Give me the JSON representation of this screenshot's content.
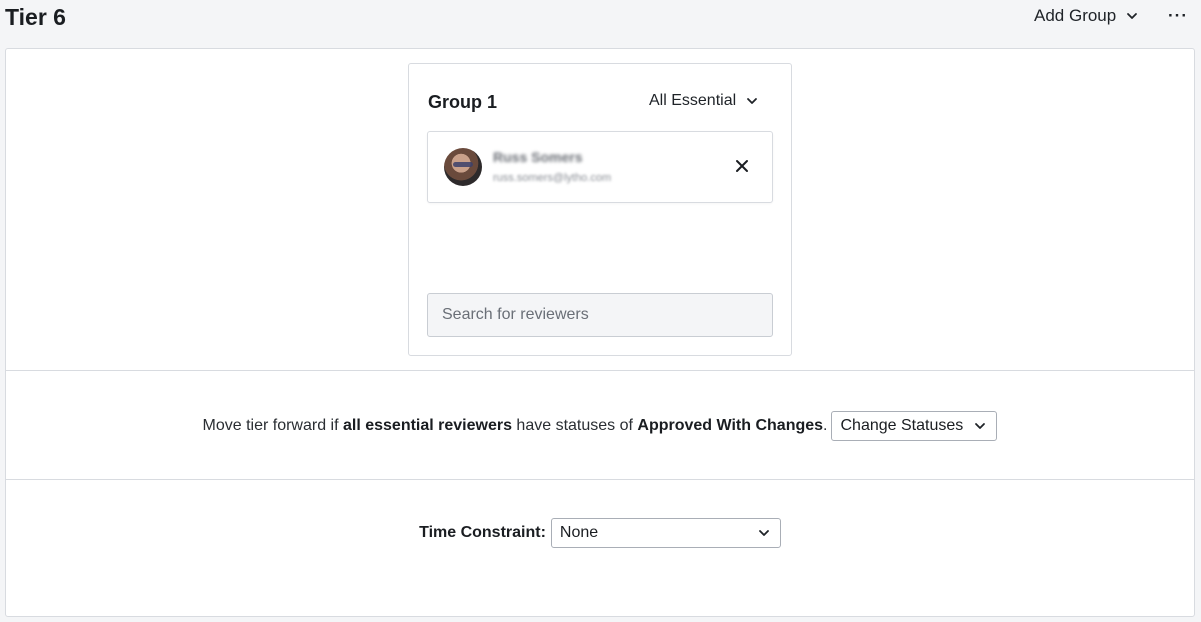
{
  "header": {
    "title": "Tier 6",
    "add_group_label": "Add Group",
    "more_label": "···"
  },
  "group": {
    "title": "Group 1",
    "essential_label": "All Essential",
    "reviewers": [
      {
        "name": "Russ Somers",
        "email": "russ.somers@lytho.com"
      }
    ],
    "remove_label": "✕",
    "search_placeholder": "Search for reviewers"
  },
  "rule": {
    "prefix": "Move tier forward if ",
    "bold_reviewers": "all essential reviewers",
    "middle": " have statuses of ",
    "bold_status": "Approved With Changes",
    "suffix": ".",
    "statuses_select": "Change Statuses"
  },
  "time_constraint": {
    "label": "Time Constraint:",
    "value": "None"
  },
  "icons": {
    "add_group_chevron": "chevron-down-icon",
    "essential_chevron": "chevron-down-icon",
    "remove": "close-icon",
    "more": "more-horizontal-icon"
  }
}
